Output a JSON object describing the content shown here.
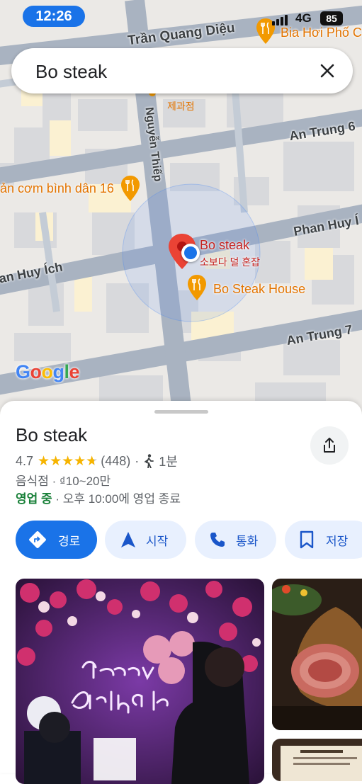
{
  "status_bar": {
    "time": "12:26",
    "network": "4G",
    "battery": "85"
  },
  "search": {
    "query": "Bo steak"
  },
  "map": {
    "streets": [
      "Trần Quang Diệu",
      "Nguyễn Thiếp",
      "An Trung 6",
      "Phan Huy Í",
      "an Huy Ích",
      "An Trung 7"
    ],
    "pois": {
      "bia_hoi": "Bia Hơi Phố C",
      "bakery": "제과점",
      "com_binh_dan": "ản cơm bình dân 16",
      "bo_steak_house": "Bo Steak House"
    },
    "selected_place": {
      "name": "Bo steak",
      "korean_name": "소보다 덜 혼잡"
    },
    "logo": "Google"
  },
  "place": {
    "name": "Bo steak",
    "rating": "4.7",
    "review_count": "(448)",
    "separator": "·",
    "walk_time": "1분",
    "category_price": "음식점 · ₫10~20만",
    "open_status": "영업 중",
    "hours": "· 오후 10:00에 영업 종료",
    "rating_stars_value": 4.7
  },
  "actions": {
    "directions": "경로",
    "start": "시작",
    "call": "통화",
    "save": "저장"
  },
  "colors": {
    "accent": "#1a73e8",
    "star": "#f6b400",
    "open": "#188038",
    "poi": "#e37400",
    "pin": "#ea4335"
  }
}
